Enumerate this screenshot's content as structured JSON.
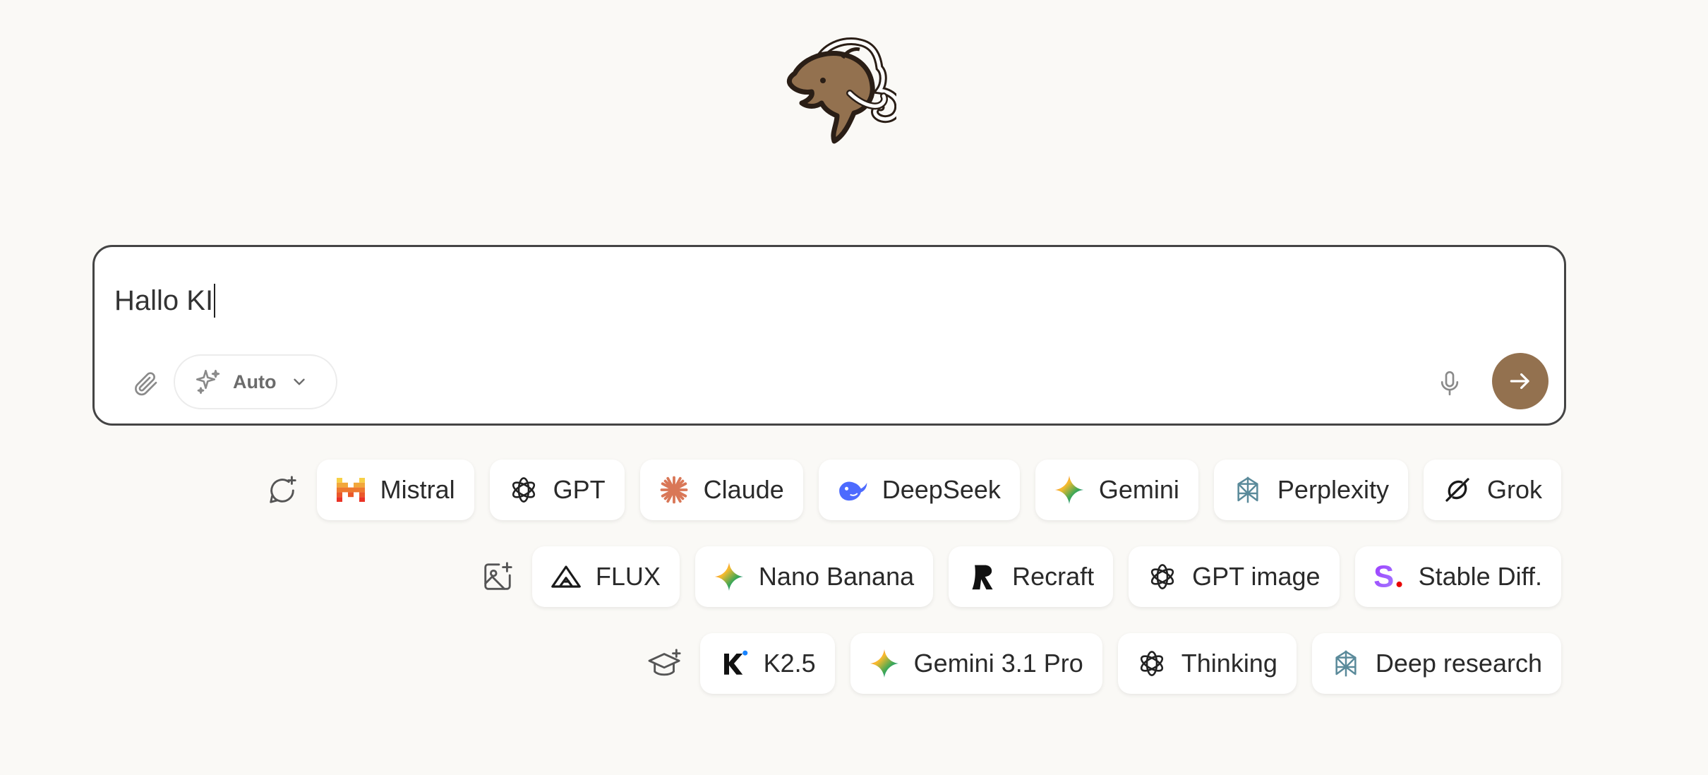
{
  "logo": {
    "icon": "mammoth-logo-icon",
    "color": "#93714f"
  },
  "composer": {
    "text": "Hallo KI",
    "attach_icon": "paperclip-icon",
    "mode": {
      "label": "Auto",
      "icon": "sparkles-icon",
      "chevron": "chevron-down-icon"
    },
    "mic_icon": "microphone-icon",
    "send_icon": "arrow-right-icon",
    "send_color": "#93714f"
  },
  "rows": [
    {
      "id": "chat",
      "icon": "chat-plus-icon",
      "chips": [
        {
          "label": "Mistral",
          "icon": "mistral-icon"
        },
        {
          "label": "GPT",
          "icon": "openai-icon"
        },
        {
          "label": "Claude",
          "icon": "claude-icon"
        },
        {
          "label": "DeepSeek",
          "icon": "deepseek-icon"
        },
        {
          "label": "Gemini",
          "icon": "gemini-icon"
        },
        {
          "label": "Perplexity",
          "icon": "perplexity-icon"
        },
        {
          "label": "Grok",
          "icon": "grok-icon"
        }
      ]
    },
    {
      "id": "image",
      "icon": "image-plus-icon",
      "chips": [
        {
          "label": "FLUX",
          "icon": "flux-icon"
        },
        {
          "label": "Nano Banana",
          "icon": "gemini-icon"
        },
        {
          "label": "Recraft",
          "icon": "recraft-icon"
        },
        {
          "label": "GPT image",
          "icon": "openai-icon"
        },
        {
          "label": "Stable Diff.",
          "icon": "stability-icon"
        }
      ]
    },
    {
      "id": "learn",
      "icon": "graduation-cap-icon",
      "chips": [
        {
          "label": "K2.5",
          "icon": "kimi-icon"
        },
        {
          "label": "Gemini 3.1 Pro",
          "icon": "gemini-icon"
        },
        {
          "label": "Thinking",
          "icon": "openai-icon"
        },
        {
          "label": "Deep research",
          "icon": "perplexity-icon"
        }
      ]
    }
  ]
}
